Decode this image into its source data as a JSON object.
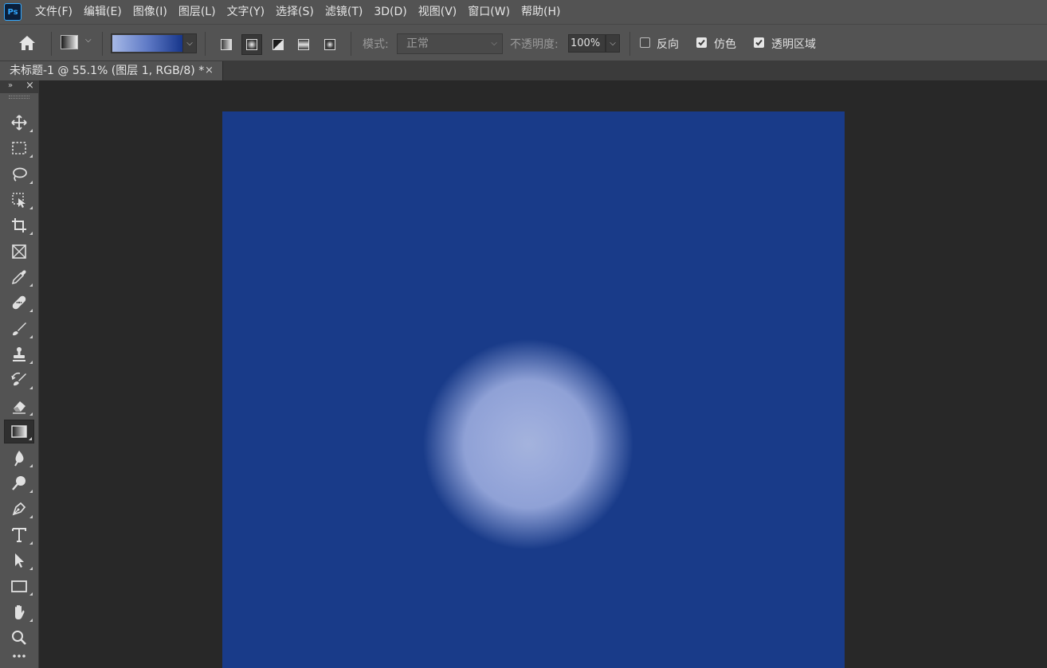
{
  "app": {
    "logo": "Ps"
  },
  "menu": [
    "文件(F)",
    "编辑(E)",
    "图像(I)",
    "图层(L)",
    "文字(Y)",
    "选择(S)",
    "滤镜(T)",
    "3D(D)",
    "视图(V)",
    "窗口(W)",
    "帮助(H)"
  ],
  "options": {
    "mode_label": "模式:",
    "mode_value": "正常",
    "opacity_label": "不透明度:",
    "opacity_value": "100%",
    "reverse_label": "反向",
    "reverse_checked": false,
    "dither_label": "仿色",
    "dither_checked": true,
    "transparency_label": "透明区域",
    "transparency_checked": true,
    "gradient_colors": [
      "#a6b8e6",
      "#17368b"
    ]
  },
  "document_tab": {
    "title": "未标题-1 @ 55.1% (图层 1, RGB/8) *",
    "close_glyph": "×"
  },
  "toolbar": {
    "collapse_glyph": "»",
    "close_glyph": "×"
  },
  "canvas": {
    "background": "#193b89",
    "glow_color": "#a4b3dd"
  },
  "tools": [
    {
      "name": "move"
    },
    {
      "name": "rect-marquee"
    },
    {
      "name": "lasso"
    },
    {
      "name": "object-select"
    },
    {
      "name": "crop"
    },
    {
      "name": "frame"
    },
    {
      "name": "eyedropper"
    },
    {
      "name": "healing-brush"
    },
    {
      "name": "brush"
    },
    {
      "name": "clone-stamp"
    },
    {
      "name": "history-brush"
    },
    {
      "name": "eraser"
    },
    {
      "name": "gradient",
      "active": true
    },
    {
      "name": "blur"
    },
    {
      "name": "dodge"
    },
    {
      "name": "pen"
    },
    {
      "name": "type"
    },
    {
      "name": "path-select"
    },
    {
      "name": "rectangle"
    },
    {
      "name": "hand"
    },
    {
      "name": "zoom"
    }
  ]
}
